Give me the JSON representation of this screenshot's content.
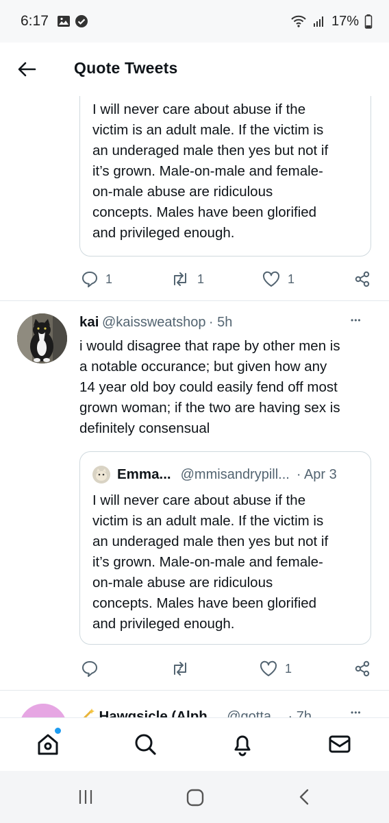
{
  "status": {
    "time": "6:17",
    "battery": "17%"
  },
  "header": {
    "title": "Quote Tweets"
  },
  "tweet1": {
    "quote_text": "I will never care about abuse if the victim is an adult male. If the victim is an underaged male then yes but not if it’s grown. Male-on-male and female-on-male abuse are ridiculous concepts. Males have been glorified and privileged enough.",
    "quote_lines": [
      "I will never care about abuse if the",
      "victim is an adult male. If the victim is",
      "an underaged male then yes but not if",
      "it’s grown. Male-on-male and female-",
      "on-male abuse are ridiculous",
      "concepts. Males have been glorified",
      "and privileged enough."
    ],
    "replies": "1",
    "retweets": "1",
    "likes": "1"
  },
  "tweet2": {
    "name": "kai",
    "handle": "@kaissweatshop",
    "time": "· 5h",
    "more": "•••",
    "body_lines": [
      "i would disagree that rape by other men is",
      "a notable occurance; but given how any",
      "14 year old boy could easily fend off most",
      "grown woman; if the two are having sex is",
      "definitely consensual"
    ],
    "quote": {
      "name": "Emma...",
      "handle": "@mmisandrypill...",
      "time": "· Apr 3",
      "lines": [
        "I will never care about abuse if the",
        "victim is an adult male. If the victim is",
        "an underaged male then yes but not if",
        "it’s grown. Male-on-male and female-",
        "on-male abuse are ridiculous",
        "concepts. Males have been glorified",
        "and privileged enough."
      ]
    },
    "likes": "1"
  },
  "tweet3": {
    "name": "Hawgsicle (Alph",
    "handle": "@gotta",
    "time": "· 7h",
    "more": "•••"
  },
  "colors": {
    "accent": "#1d9bf0",
    "secondary": "#536471",
    "border": "#cfd9de"
  }
}
